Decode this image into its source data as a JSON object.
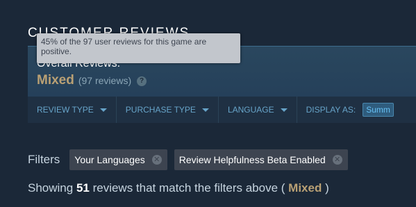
{
  "section": {
    "title": "CUSTOMER REVIEWS"
  },
  "summary": {
    "label": "Overall Reviews:",
    "rating": "Mixed",
    "count": "(97 reviews)",
    "help_glyph": "?"
  },
  "tooltip": {
    "text": "45% of the 97 user reviews for this game are positive."
  },
  "filter_bar": {
    "review_type": "REVIEW TYPE",
    "purchase_type": "PURCHASE TYPE",
    "language": "LANGUAGE",
    "display_as_label": "DISPLAY AS:",
    "display_as_value": "Summ"
  },
  "filters": {
    "label": "Filters",
    "chips": [
      {
        "label": "Your Languages"
      },
      {
        "label": "Review Helpfulness Beta Enabled"
      }
    ]
  },
  "results": {
    "prefix": "Showing ",
    "count": "51",
    "middle": " reviews that match the filters above ( ",
    "rating": "Mixed",
    "suffix": " )"
  },
  "colors": {
    "background": "#1b2838",
    "mixed": "#b9a074",
    "link_blue": "#67a4c9"
  }
}
